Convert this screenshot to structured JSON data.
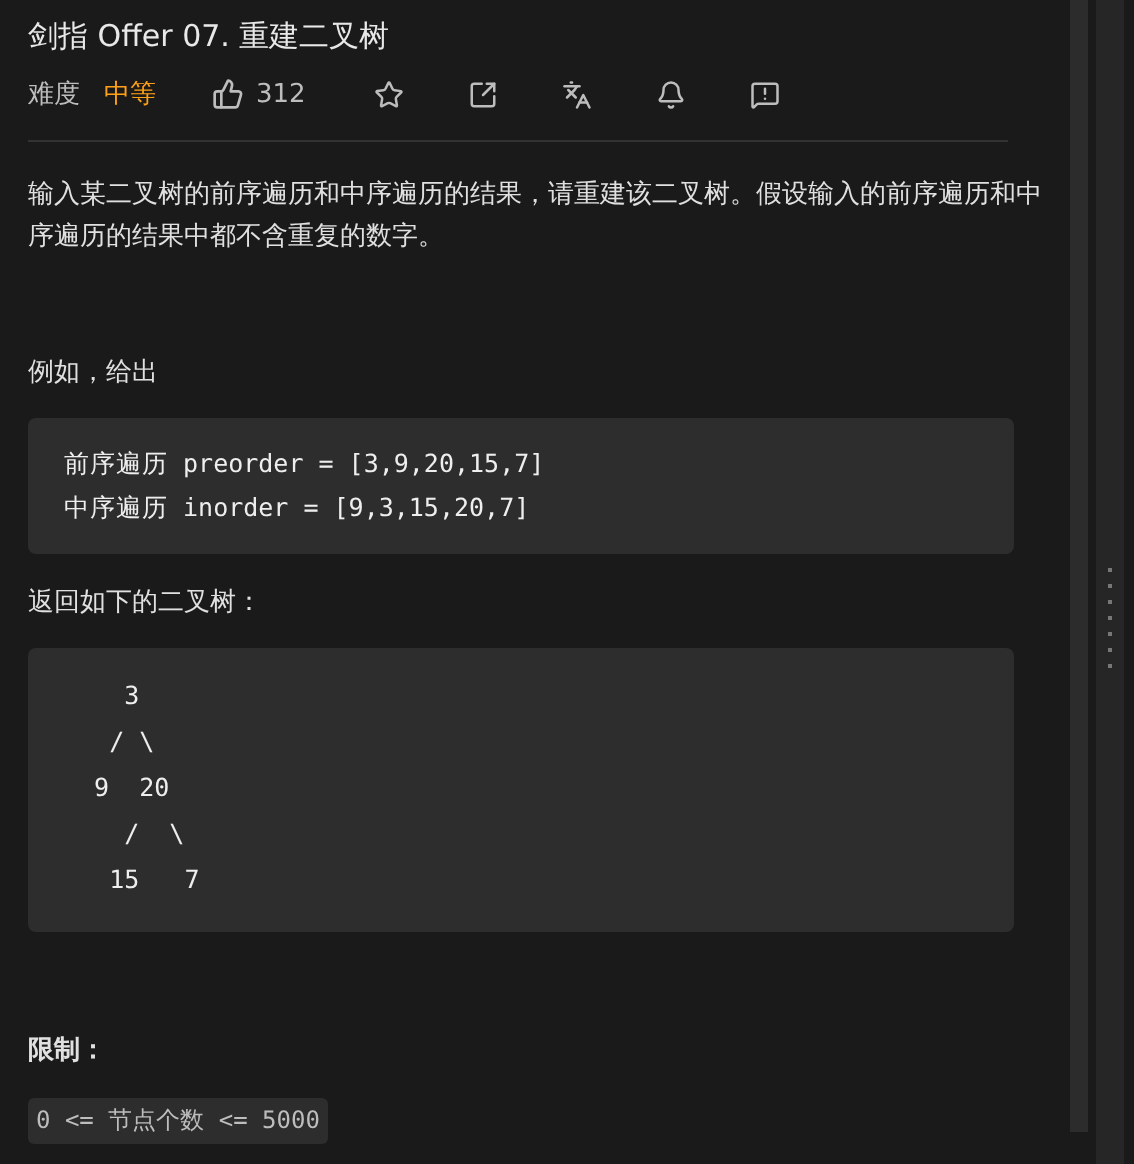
{
  "title": "剑指 Offer 07. 重建二叉树",
  "meta": {
    "difficulty_label": "难度",
    "difficulty": "中等",
    "likes": "312"
  },
  "description": "输入某二叉树的前序遍历和中序遍历的结果，请重建该二叉树。假设输入的前序遍历和中序遍历的结果中都不含重复的数字。",
  "example_intro": "例如，给出",
  "example_code": [
    "前序遍历 preorder = [3,9,20,15,7]",
    "中序遍历 inorder = [9,3,15,20,7]"
  ],
  "result_intro": "返回如下的二叉树：",
  "tree_code": [
    "    3",
    "   / \\",
    "  9  20",
    "    /  \\",
    "   15   7"
  ],
  "constraints_heading": "限制：",
  "constraint": "0 <= 节点个数 <= 5000"
}
